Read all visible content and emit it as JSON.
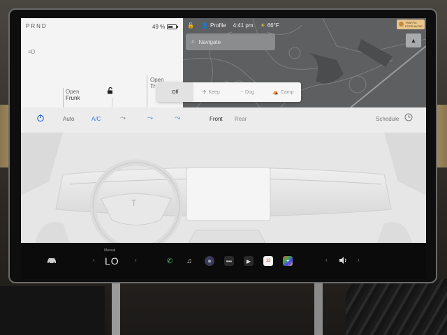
{
  "status": {
    "gear": "PRND",
    "battery": "49 %",
    "profile_label": "Profile",
    "time": "4:41 pm",
    "temperature": "66°F"
  },
  "car": {
    "frunk_state": "Open",
    "frunk_label": "Frunk",
    "trunk_state": "Open",
    "trunk_label": "Tr"
  },
  "map": {
    "navigate_placeholder": "Navigate",
    "compass_glyph": "▲",
    "traffic_badge_text": "TRAFFIC POOR AVOID"
  },
  "keep_popup": {
    "options": [
      {
        "label": "Off",
        "icon": "none",
        "active": true
      },
      {
        "label": "Keep",
        "icon": "fan-icon",
        "active": false
      },
      {
        "label": "Dog",
        "icon": "dog-icon",
        "active": false
      },
      {
        "label": "Camp",
        "icon": "tent-icon",
        "active": false
      }
    ]
  },
  "climate": {
    "auto_label": "Auto",
    "ac_label": "A/C",
    "front_label": "Front",
    "rear_label": "Rear",
    "schedule_label": "Schedule",
    "fan_speed": "3",
    "accent_color": "#2f6fd6"
  },
  "dock": {
    "temp_mode_label": "Manual",
    "temp_value": "LO",
    "calendar_day": "13",
    "apps": [
      "phone-icon",
      "music-icon",
      "camera-icon",
      "more-icon",
      "video-icon",
      "calendar-icon",
      "toybox-icon"
    ]
  }
}
